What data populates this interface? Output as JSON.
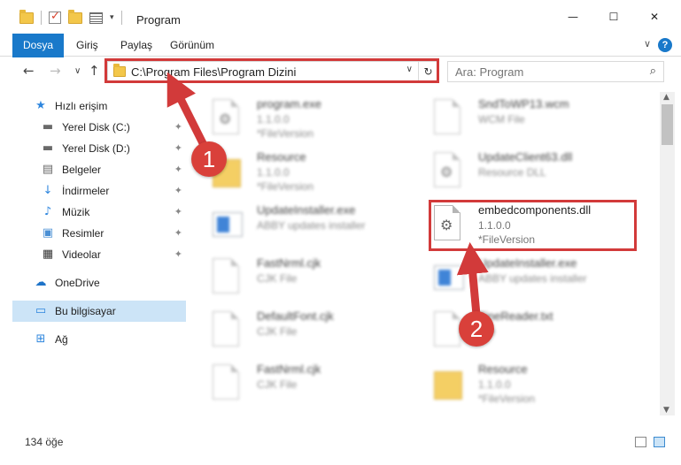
{
  "window": {
    "title": "Program",
    "minimize_glyph": "—",
    "maximize_glyph": "☐",
    "close_glyph": "✕"
  },
  "ribbon": {
    "tabs": [
      "Dosya",
      "Giriş",
      "Paylaş",
      "Görünüm"
    ],
    "help_glyph": "?",
    "collapse_glyph": "∨"
  },
  "nav": {
    "back_glyph": "←",
    "forward_glyph": "→",
    "recent_glyph": "∨",
    "up_glyph": "↑",
    "address": "C:\\Program Files\\Program Dizini",
    "address_dropdown_glyph": "∨",
    "refresh_glyph": "↻",
    "search_placeholder": "Ara: Program",
    "search_glyph": "⌕"
  },
  "sidebar": {
    "items": [
      {
        "label": "Hızlı erişim",
        "icon": "star-icon",
        "glyph": "★",
        "color": "#2e86de",
        "pinned": false
      },
      {
        "label": "Yerel Disk (C:)",
        "icon": "drive-icon",
        "glyph": "▬",
        "color": "#6a6a6a",
        "pinned": true
      },
      {
        "label": "Yerel Disk (D:)",
        "icon": "drive-icon",
        "glyph": "▬",
        "color": "#6a6a6a",
        "pinned": true
      },
      {
        "label": "Belgeler",
        "icon": "documents-icon",
        "glyph": "▤",
        "color": "#6a6a6a",
        "pinned": true
      },
      {
        "label": "İndirmeler",
        "icon": "download-icon",
        "glyph": "↓",
        "color": "#2e86de",
        "pinned": true
      },
      {
        "label": "Müzik",
        "icon": "music-icon",
        "glyph": "♪",
        "color": "#2e86de",
        "pinned": true
      },
      {
        "label": "Resimler",
        "icon": "pictures-icon",
        "glyph": "▣",
        "color": "#4a8fd4",
        "pinned": true
      },
      {
        "label": "Videolar",
        "icon": "video-icon",
        "glyph": "▦",
        "color": "#333333",
        "pinned": true
      },
      {
        "label": "OneDrive",
        "icon": "cloud-icon",
        "glyph": "☁",
        "color": "#1e73c8",
        "pinned": false
      },
      {
        "label": "Bu bilgisayar",
        "icon": "computer-icon",
        "glyph": "▭",
        "color": "#2e86de",
        "pinned": false,
        "selected": true
      },
      {
        "label": "Ağ",
        "icon": "network-icon",
        "glyph": "⊞",
        "color": "#2e86de",
        "pinned": false
      }
    ],
    "pin_glyph": "✦"
  },
  "files": [
    {
      "name": "program.exe",
      "line2": "1.1.0.0",
      "line3": "*FileVersion",
      "icon": "exe-icon",
      "blurred": true
    },
    {
      "name": "SndToWP13.wcm",
      "line2": "WCM File",
      "line3": "",
      "icon": "document-icon",
      "blurred": true
    },
    {
      "name": "Resource",
      "line2": "1.1.0.0",
      "line3": "*FileVersion",
      "icon": "folder-icon",
      "blurred": true
    },
    {
      "name": "UpdateClient63.dll",
      "line2": "Resource DLL",
      "line3": "",
      "icon": "dll-icon",
      "blurred": true
    },
    {
      "name": "UpdateInstaller.exe",
      "line2": "ABBY updates installer",
      "line3": "",
      "icon": "installer-icon",
      "blurred": true
    },
    {
      "name": "embedcomponents.dll",
      "line2": "1.1.0.0",
      "line3": "*FileVersion",
      "icon": "dll-gear-icon",
      "blurred": false
    },
    {
      "name": "FastNrml.cjk",
      "line2": "CJK File",
      "line3": "",
      "icon": "document-icon",
      "blurred": true
    },
    {
      "name": "UpdateInstaller.exe",
      "line2": "ABBY updates installer",
      "line3": "",
      "icon": "installer-icon",
      "blurred": true
    },
    {
      "name": "DefaultFont.cjk",
      "line2": "CJK File",
      "line3": "",
      "icon": "document-icon",
      "blurred": true
    },
    {
      "name": "FineReader.txt",
      "line2": "File",
      "line3": "",
      "icon": "document-icon",
      "blurred": true
    },
    {
      "name": "FastNrml.cjk",
      "line2": "CJK File",
      "line3": "",
      "icon": "document-icon",
      "blurred": true
    },
    {
      "name": "Resource",
      "line2": "1.1.0.0",
      "line3": "*FileVersion",
      "icon": "folder-icon",
      "blurred": true
    }
  ],
  "status": {
    "count": "134 öğe"
  },
  "annotations": {
    "badge1": "1",
    "badge2": "2",
    "color": "#d23a3a"
  }
}
